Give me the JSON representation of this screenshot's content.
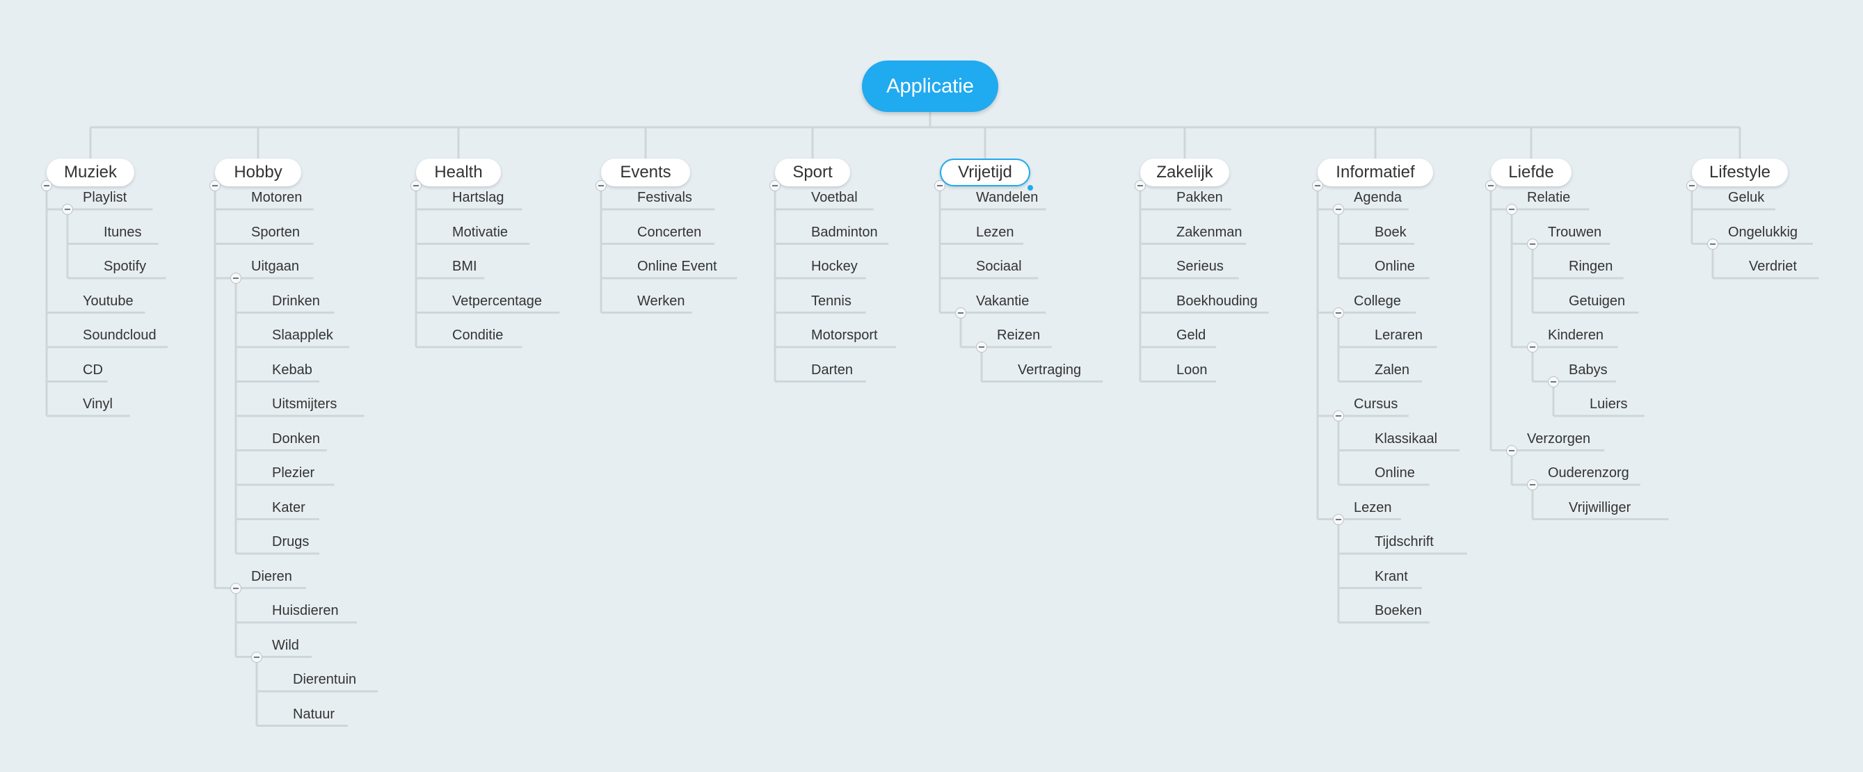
{
  "root": {
    "label": "Applicatie"
  },
  "colors": {
    "root": "#20aaf0",
    "line": "#cfd6da",
    "background": "#e7eef2"
  },
  "branches": [
    {
      "label": "Muziek",
      "children": [
        {
          "label": "Playlist",
          "children": [
            {
              "label": "Itunes"
            },
            {
              "label": "Spotify"
            }
          ]
        },
        {
          "label": "Youtube"
        },
        {
          "label": "Soundcloud"
        },
        {
          "label": "CD"
        },
        {
          "label": "Vinyl"
        }
      ]
    },
    {
      "label": "Hobby",
      "children": [
        {
          "label": "Motoren"
        },
        {
          "label": "Sporten"
        },
        {
          "label": "Uitgaan",
          "children": [
            {
              "label": "Drinken"
            },
            {
              "label": "Slaapplek"
            },
            {
              "label": "Kebab"
            },
            {
              "label": "Uitsmijters"
            },
            {
              "label": "Donken"
            },
            {
              "label": "Plezier"
            },
            {
              "label": "Kater"
            },
            {
              "label": "Drugs"
            }
          ]
        },
        {
          "label": "Dieren",
          "children": [
            {
              "label": "Huisdieren"
            },
            {
              "label": "Wild",
              "children": [
                {
                  "label": "Dierentuin"
                },
                {
                  "label": "Natuur"
                }
              ]
            }
          ]
        }
      ]
    },
    {
      "label": "Health",
      "children": [
        {
          "label": "Hartslag"
        },
        {
          "label": "Motivatie"
        },
        {
          "label": "BMI"
        },
        {
          "label": "Vetpercentage"
        },
        {
          "label": "Conditie"
        }
      ]
    },
    {
      "label": "Events",
      "children": [
        {
          "label": "Festivals"
        },
        {
          "label": "Concerten"
        },
        {
          "label": "Online Event"
        },
        {
          "label": "Werken"
        }
      ]
    },
    {
      "label": "Sport",
      "children": [
        {
          "label": "Voetbal"
        },
        {
          "label": "Badminton"
        },
        {
          "label": "Hockey"
        },
        {
          "label": "Tennis"
        },
        {
          "label": "Motorsport"
        },
        {
          "label": "Darten"
        }
      ]
    },
    {
      "label": "Vrijetijd",
      "selected": true,
      "children": [
        {
          "label": "Wandelen"
        },
        {
          "label": "Lezen"
        },
        {
          "label": "Sociaal"
        },
        {
          "label": "Vakantie",
          "children": [
            {
              "label": "Reizen",
              "children": [
                {
                  "label": "Vertraging"
                }
              ]
            }
          ]
        }
      ]
    },
    {
      "label": "Zakelijk",
      "children": [
        {
          "label": "Pakken"
        },
        {
          "label": "Zakenman"
        },
        {
          "label": "Serieus"
        },
        {
          "label": "Boekhouding"
        },
        {
          "label": "Geld"
        },
        {
          "label": "Loon"
        }
      ]
    },
    {
      "label": "Informatief",
      "children": [
        {
          "label": "Agenda",
          "children": [
            {
              "label": "Boek"
            },
            {
              "label": "Online"
            }
          ]
        },
        {
          "label": "College",
          "children": [
            {
              "label": "Leraren"
            },
            {
              "label": "Zalen"
            }
          ]
        },
        {
          "label": "Cursus",
          "children": [
            {
              "label": "Klassikaal"
            },
            {
              "label": "Online"
            }
          ]
        },
        {
          "label": "Lezen",
          "children": [
            {
              "label": "Tijdschrift"
            },
            {
              "label": "Krant"
            },
            {
              "label": "Boeken"
            }
          ]
        }
      ]
    },
    {
      "label": "Liefde",
      "children": [
        {
          "label": "Relatie",
          "children": [
            {
              "label": "Trouwen",
              "children": [
                {
                  "label": "Ringen"
                },
                {
                  "label": "Getuigen"
                }
              ]
            },
            {
              "label": "Kinderen",
              "children": [
                {
                  "label": "Babys",
                  "children": [
                    {
                      "label": "Luiers"
                    }
                  ]
                }
              ]
            }
          ]
        },
        {
          "label": "Verzorgen",
          "children": [
            {
              "label": "Ouderenzorg",
              "children": [
                {
                  "label": "Vrijwilliger"
                }
              ]
            }
          ]
        }
      ]
    },
    {
      "label": "Lifestyle",
      "children": [
        {
          "label": "Geluk"
        },
        {
          "label": "Ongelukkig",
          "children": [
            {
              "label": "Verdriet"
            }
          ]
        }
      ]
    }
  ]
}
